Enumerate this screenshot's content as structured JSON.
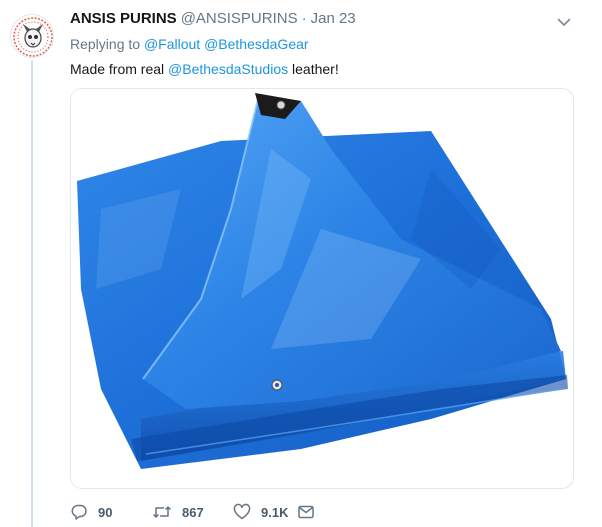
{
  "tweet": {
    "display_name": "ANSIS PURINS",
    "handle": "@ANSISPURINS",
    "separator": "·",
    "date": "Jan 23",
    "replying_prefix": "Replying to",
    "replying_to": [
      "@Fallout",
      "@BethesdaGear"
    ],
    "text_before": "Made from real",
    "text_mention": "@BethesdaStudios",
    "text_after": "leather!"
  },
  "media": {
    "subject": "folded blue tarp"
  },
  "actions": {
    "reply_count": "90",
    "retweet_count": "867",
    "like_count": "9.1K"
  },
  "icons": {
    "more": "chevron-down-icon",
    "reply": "reply-icon",
    "retweet": "retweet-icon",
    "like": "heart-icon",
    "dm": "envelope-icon"
  },
  "colors": {
    "link": "#1b95e0",
    "secondary_text": "#657786",
    "thread_line": "#cfe3ef",
    "tarp_blue": "#1f6fd6"
  }
}
